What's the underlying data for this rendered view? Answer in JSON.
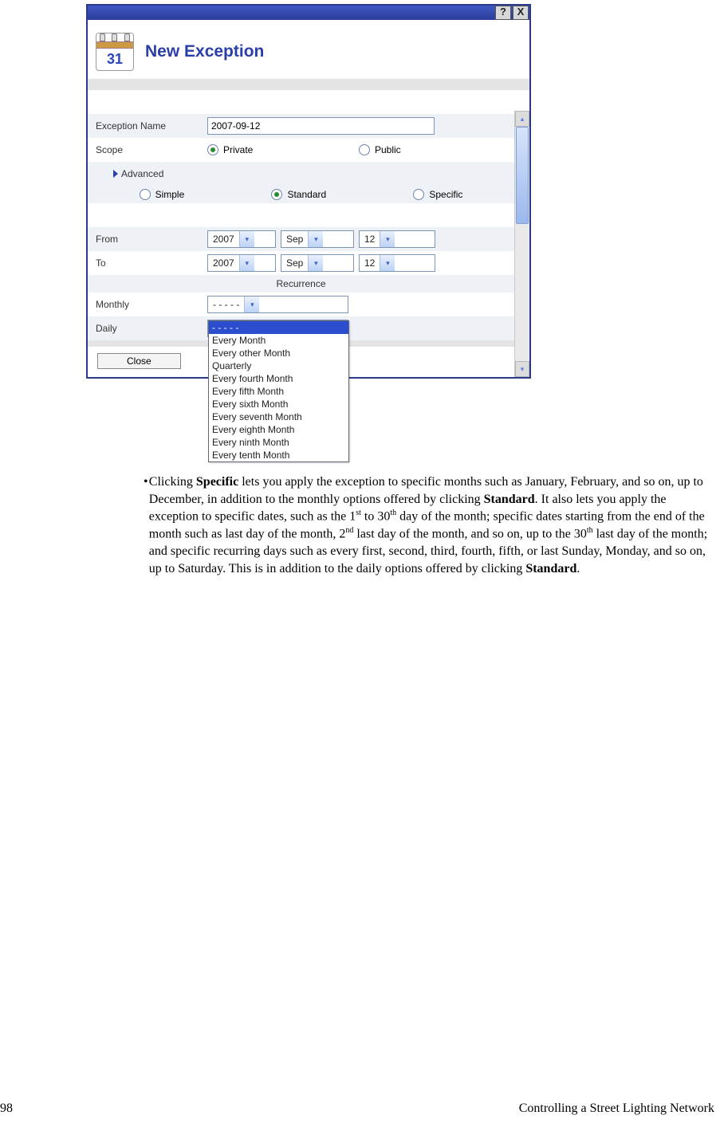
{
  "titlebar": {
    "help": "?",
    "close": "X"
  },
  "dialog": {
    "icon_number": "31",
    "title": "New Exception",
    "exception_name_label": "Exception Name",
    "exception_name_value": "2007-09-12",
    "scope_label": "Scope",
    "scope_private": "Private",
    "scope_public": "Public",
    "advanced_label": "Advanced",
    "level_simple": "Simple",
    "level_standard": "Standard",
    "level_specific": "Specific",
    "from_label": "From",
    "to_label": "To",
    "from_year": "2007",
    "from_month": "Sep",
    "from_day": "12",
    "to_year": "2007",
    "to_month": "Sep",
    "to_day": "12",
    "recurrence_label": "Recurrence",
    "monthly_label": "Monthly",
    "monthly_value": "- - - - -",
    "daily_label": "Daily",
    "close_button": "Close",
    "dropdown_selected": "- - - - -",
    "dropdown_items": [
      "Every Month",
      "Every other Month",
      "Quarterly",
      "Every fourth Month",
      "Every fifth Month",
      "Every sixth Month",
      "Every seventh Month",
      "Every eighth Month",
      "Every ninth Month",
      "Every tenth Month"
    ]
  },
  "doc": {
    "p1a": "Clicking ",
    "b1": "Specific",
    "p1b": " lets you apply the exception to specific months such as January, February, and so on, up to December, in addition to the monthly options offered by clicking ",
    "b2": "Standard",
    "p1c": ".  It also lets you apply the exception to specific dates, such as the 1",
    "sup1": "st",
    "p1d": " to 30",
    "sup2": "th",
    "p1e": " day of the month; specific dates starting from the end of the month such as last day of the month, 2",
    "sup3": "nd",
    "p1f": " last day of the month, and so on, up to the 30",
    "sup4": "th",
    "p1g": " last day of the month; and specific recurring days such as every first, second, third, fourth, fifth, or last Sunday, Monday, and so on, up to Saturday.  This is in addition to the daily options offered by clicking ",
    "b3": "Standard",
    "p1h": "."
  },
  "footer": {
    "page_num": "98",
    "title": "Controlling a Street Lighting Network"
  }
}
